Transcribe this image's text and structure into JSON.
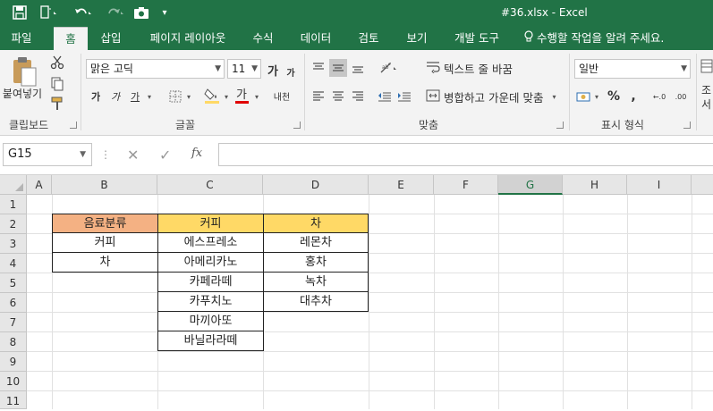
{
  "window": {
    "title": "#36.xlsx - Excel"
  },
  "quick_access": {
    "save_icon": "save-icon",
    "touch_icon": "touch-mode-icon",
    "undo_icon": "undo-icon",
    "redo_icon": "redo-icon",
    "camera_icon": "camera-icon",
    "customize_icon": "customize-icon"
  },
  "tabs": [
    {
      "label": "파일"
    },
    {
      "label": "홈"
    },
    {
      "label": "삽입"
    },
    {
      "label": "페이지 레이아웃"
    },
    {
      "label": "수식"
    },
    {
      "label": "데이터"
    },
    {
      "label": "검토"
    },
    {
      "label": "보기"
    },
    {
      "label": "개발 도구"
    }
  ],
  "tell_me": "수행할 작업을 알려 주세요.",
  "ribbon": {
    "clipboard": {
      "label": "클립보드",
      "paste_label": "붙여넣기"
    },
    "font": {
      "label": "글꼴",
      "font_name": "맑은 고딕",
      "font_size": "11",
      "grow": "가",
      "shrink": "가",
      "bold": "가",
      "italic": "가",
      "underline": "가",
      "font_color_glyph": "가",
      "phonetic": "내천"
    },
    "alignment": {
      "label": "맞춤",
      "wrap_text": "텍스트 줄 바꿈",
      "merge_center": "병합하고 가운데 맞춤"
    },
    "number": {
      "label": "표시 형식",
      "format": "일반",
      "percent": "%",
      "comma": ",",
      "inc_decimal": "←.0",
      "dec_decimal": ".00"
    },
    "styles": {
      "label1": "조",
      "label2": "서"
    }
  },
  "formula_bar": {
    "name_box": "G15",
    "dots": "⋮",
    "cancel": "✕",
    "enter": "✓",
    "fx": "fx",
    "formula": ""
  },
  "columns": [
    "A",
    "B",
    "C",
    "D",
    "E",
    "F",
    "G",
    "H",
    "I"
  ],
  "selected_column": "G",
  "rows": [
    "1",
    "2",
    "3",
    "4",
    "5",
    "6",
    "7",
    "8",
    "9",
    "10",
    "11"
  ],
  "table": {
    "b2": "음료분류",
    "b_items": [
      "커피",
      "차"
    ],
    "c2": "커피",
    "c_items": [
      "에스프레소",
      "아메리카노",
      "카페라떼",
      "카푸치노",
      "마끼아또",
      "바닐라라떼"
    ],
    "d2": "차",
    "d_items": [
      "레몬차",
      "홍차",
      "녹차",
      "대추차"
    ]
  },
  "colors": {
    "accent": "#217346",
    "orange_header": "#f4b183",
    "yellow_header": "#ffd966"
  }
}
